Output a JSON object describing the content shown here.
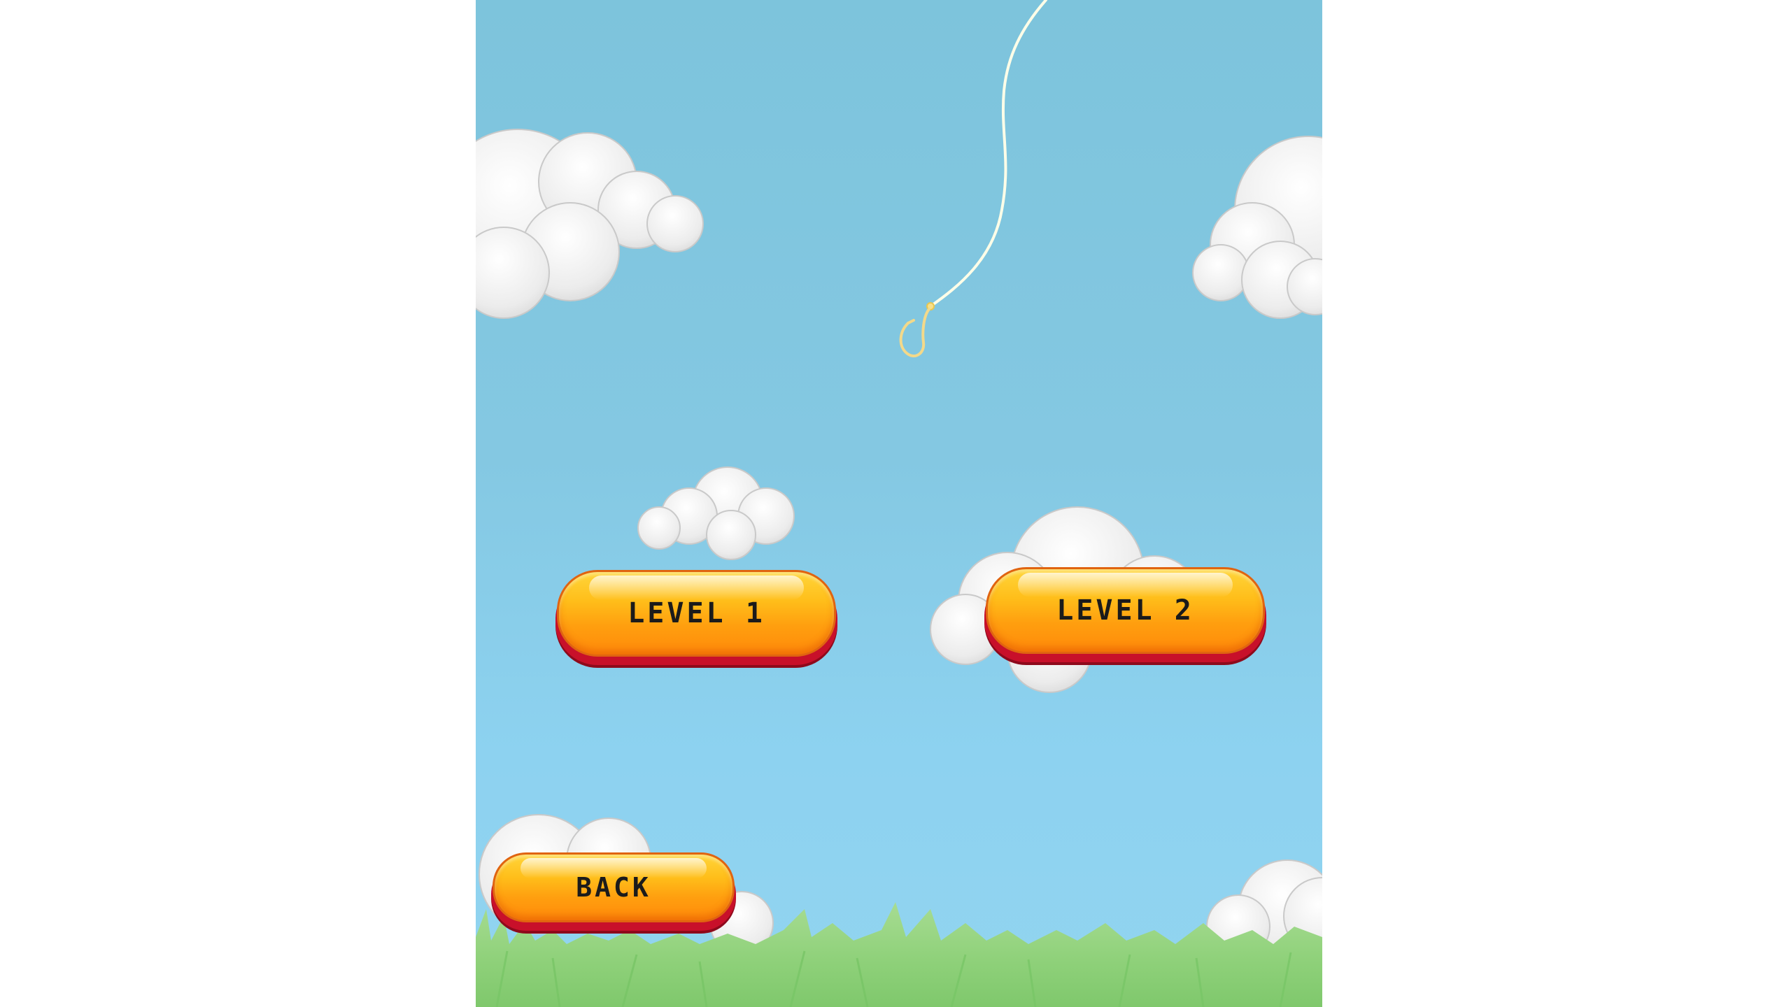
{
  "menu": {
    "level1_label": "LEVEL 1",
    "level2_label": "LEVEL 2",
    "back_label": "BACK"
  },
  "colors": {
    "sky": "#84c8e2",
    "button_face": "#ffb516",
    "button_base": "#c8102a",
    "grass": "#8cd47a",
    "cloud": "#f4f4f4"
  },
  "icons": [
    "cloud-icon",
    "fishing-hook-icon",
    "grass"
  ]
}
